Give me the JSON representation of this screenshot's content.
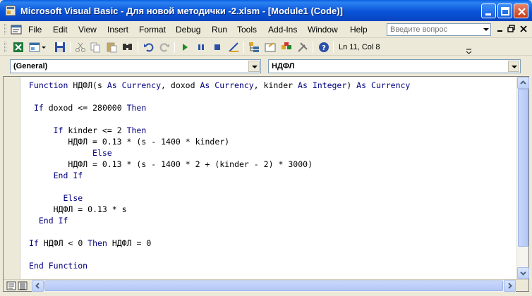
{
  "window": {
    "title": "Microsoft Visual Basic - Для новой методички -2.xlsm - [Module1 (Code)]"
  },
  "menu": {
    "items": [
      "File",
      "Edit",
      "View",
      "Insert",
      "Format",
      "Debug",
      "Run",
      "Tools",
      "Add-Ins",
      "Window",
      "Help"
    ],
    "help_placeholder": "Введите вопрос"
  },
  "toolbar": {
    "icons": [
      "excel-icon",
      "insert-userform-icon",
      "save-icon",
      "cut-icon",
      "copy-icon",
      "paste-icon",
      "find-icon",
      "undo-icon",
      "redo-icon",
      "run-icon",
      "break-icon",
      "reset-icon",
      "design-mode-icon",
      "project-explorer-icon",
      "properties-icon",
      "object-browser-icon",
      "toolbox-icon",
      "help-icon"
    ],
    "position": "Ln 11, Col 8"
  },
  "combos": {
    "object": "(General)",
    "procedure": "НДФЛ"
  },
  "code": {
    "lines": [
      "Function НДФЛ(s As Currency, doxod As Currency, kinder As Integer) As Currency",
      "",
      " If doxod <= 280000 Then",
      "",
      "     If kinder <= 2 Then",
      "        НДФЛ = 0.13 * (s - 1400 * kinder)",
      "             Else",
      "        НДФЛ = 0.13 * (s - 1400 * 2 + (kinder - 2) * 3000)",
      "     End If",
      "",
      "       Else",
      "     НДФЛ = 0.13 * s",
      "  End If",
      "",
      "If НДФЛ < 0 Then НДФЛ = 0",
      "",
      "End Function"
    ]
  },
  "colors": {
    "keyword": "#000080",
    "titlebar": "#0a53d8"
  }
}
